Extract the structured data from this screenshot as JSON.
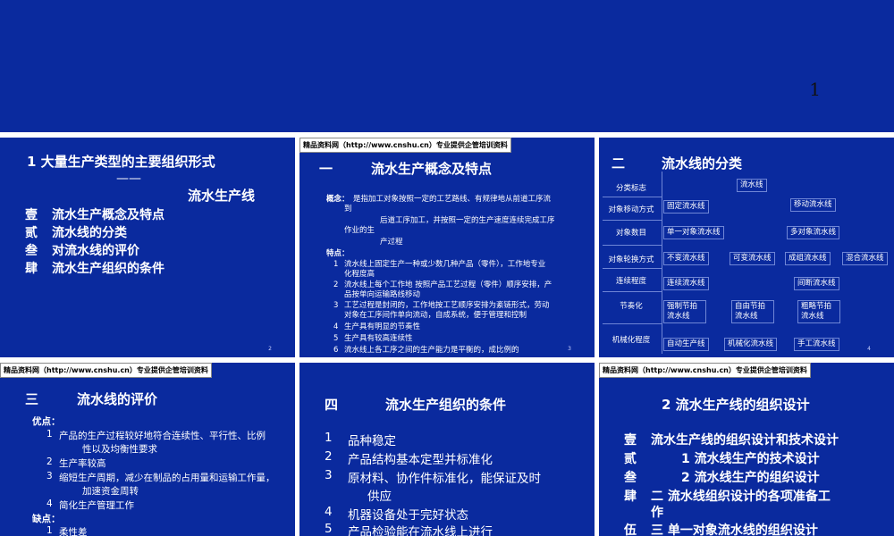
{
  "top": {
    "page_number": "1"
  },
  "slide1": {
    "title": "1 大量生产类型的主要组织形式",
    "dash": "——",
    "subtitle": "流水生产线",
    "items": [
      {
        "num": "壹",
        "text": "流水生产概念及特点"
      },
      {
        "num": "贰",
        "text": "流水线的分类"
      },
      {
        "num": "叁",
        "text": "对流水线的评价"
      },
      {
        "num": "肆",
        "text": "流水生产组织的条件"
      }
    ],
    "page": "2"
  },
  "slide2": {
    "banner": "精品资料网（http://www.cnshu.cn）专业提供企管培训资料",
    "heading_num": "一",
    "heading": "流水生产概念及特点",
    "concept_label": "概念：",
    "concept_line1": "是指加工对象按照一定的工艺路线、有规律地从前道工序流",
    "concept_line2": "到",
    "concept_line3": "后道工序加工，并按照一定的生产速度连续完成工序",
    "concept_line4": "作业的生",
    "concept_line5": "产过程",
    "features_label": "特点：",
    "features": [
      {
        "n": "1",
        "l1": "流水线上固定生产一种或少数几种产品（零件），工作地专业",
        "l2": "化程度高"
      },
      {
        "n": "2",
        "l1": "流水线上每个工作地  按照产品工艺过程（零件）顺序安排，产",
        "l2": "品按单向运输路线移动"
      },
      {
        "n": "3",
        "l1": "工艺过程是封闭的，工作地按工艺顺序安排为紊链形式，劳动",
        "l2": "对象在工序间作单向流动，自成系统，便于管理和控制"
      },
      {
        "n": "4",
        "l1": "生产具有明显的节奏性",
        "l2": ""
      },
      {
        "n": "5",
        "l1": "生产具有较高连续性",
        "l2": ""
      },
      {
        "n": "6",
        "l1": "流水线上各工序之间的生产能力是平衡的，成比例的",
        "l2": ""
      }
    ],
    "page": "3"
  },
  "slide3": {
    "heading_num": "二",
    "heading": "流水线的分类",
    "rows": [
      {
        "label": "分类标志",
        "boxes": [
          "流水线"
        ]
      },
      {
        "label": "对象移动方式",
        "boxes": [
          "固定流水线",
          "移动流水线"
        ]
      },
      {
        "label": "对象数目",
        "boxes": [
          "单一对象流水线",
          "多对象流水线"
        ]
      },
      {
        "label": "对象轮换方式",
        "boxes": [
          "不变流水线",
          "可变流水线",
          "成组流水线",
          "混合流水线"
        ]
      },
      {
        "label": "连续程度",
        "boxes": [
          "连续流水线",
          "间断流水线"
        ]
      },
      {
        "label": "节奏化",
        "boxes": [
          "强制节拍流水线",
          "自由节拍流水线",
          "粗略节拍流水线"
        ]
      },
      {
        "label": "机械化程度",
        "boxes": [
          "自动生产线",
          "机械化流水线",
          "手工流水线"
        ]
      }
    ],
    "page": "4"
  },
  "slide4": {
    "banner": "精品资料网（http://www.cnshu.cn）专业提供企管培训资料",
    "heading_num": "三",
    "heading": "流水线的评价",
    "pros_label": "优点：",
    "pros": [
      {
        "n": "1",
        "l1": "产品的生产过程较好地符合连续性、平行性、比例",
        "l2": "性以及均衡性要求"
      },
      {
        "n": "2",
        "l1": "生产率较高",
        "l2": ""
      },
      {
        "n": "3",
        "l1": "缩短生产周期，减少在制品的占用量和运输工作量，",
        "l2": "加速资金周转"
      },
      {
        "n": "4",
        "l1": "简化生产管理工作",
        "l2": ""
      }
    ],
    "cons_label": "缺点：",
    "cons": [
      {
        "n": "1",
        "l1": "柔性差"
      }
    ]
  },
  "slide5": {
    "heading_num": "四",
    "heading": "流水生产组织的条件",
    "items": [
      {
        "n": "1",
        "l1": "品种稳定",
        "l2": ""
      },
      {
        "n": "2",
        "l1": "产品结构基本定型并标准化",
        "l2": ""
      },
      {
        "n": "3",
        "l1": "原材料、协作件标准化，能保证及时",
        "l2": "供应"
      },
      {
        "n": "4",
        "l1": "机器设备处于完好状态",
        "l2": ""
      },
      {
        "n": "5",
        "l1": "产品检验能在流水线上进行",
        "l2": ""
      }
    ]
  },
  "slide6": {
    "banner": "精品资料网（http://www.cnshu.cn）专业提供企管培训资料",
    "heading": "2  流水生产线的组织设计",
    "items": [
      {
        "num": "壹",
        "text": "流水生产线的组织设计和技术设计"
      },
      {
        "num": "贰",
        "text": "1 流水线生产的技术设计"
      },
      {
        "num": "叁",
        "text": "2 流水线生产的组织设计"
      },
      {
        "num": "肆",
        "text": "二        流水线组织设计的各项准备工"
      },
      {
        "num": "",
        "text": "作"
      },
      {
        "num": "伍",
        "text": "三        单一对象流水线的组织设计"
      }
    ]
  }
}
